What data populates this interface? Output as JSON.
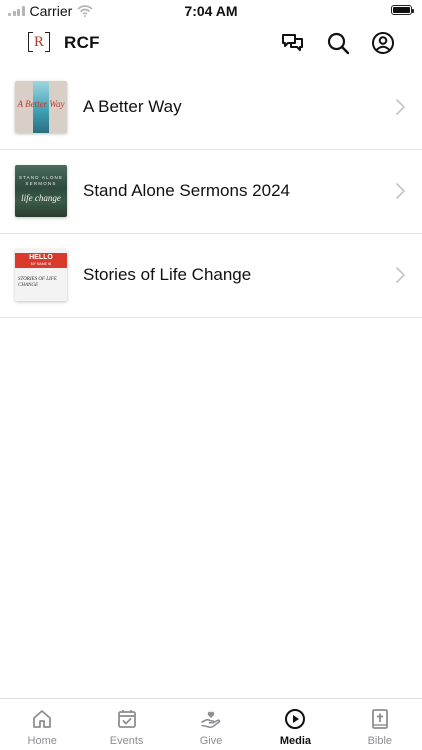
{
  "status_bar": {
    "carrier": "Carrier",
    "time": "7:04 AM"
  },
  "header": {
    "logo_letter": "R",
    "title": "RCF",
    "icons": [
      "chat-icon",
      "search-icon",
      "account-icon"
    ]
  },
  "list": {
    "items": [
      {
        "label": "A Better Way",
        "thumbnail_text": "A Better Way"
      },
      {
        "label": "Stand Alone Sermons 2024",
        "thumbnail_text": "STAND ALONE SERMONS",
        "thumbnail_script": "life change"
      },
      {
        "label": "Stories of Life Change",
        "thumbnail_badge": "HELLO",
        "thumbnail_badge_sub": "MY NAME IS",
        "thumbnail_script": "STORIES OF LIFE CHANGE"
      }
    ]
  },
  "tab_bar": {
    "tabs": [
      {
        "label": "Home",
        "icon": "home-icon",
        "active": false
      },
      {
        "label": "Events",
        "icon": "calendar-check-icon",
        "active": false
      },
      {
        "label": "Give",
        "icon": "give-hand-heart-icon",
        "active": false
      },
      {
        "label": "Media",
        "icon": "play-circle-icon",
        "active": true
      },
      {
        "label": "Bible",
        "icon": "bible-icon",
        "active": false
      }
    ]
  },
  "colors": {
    "accent": "#111111",
    "inactive_tab": "#8e8e93",
    "logo_red": "#b33a2f",
    "divider": "#e4e4e4"
  }
}
